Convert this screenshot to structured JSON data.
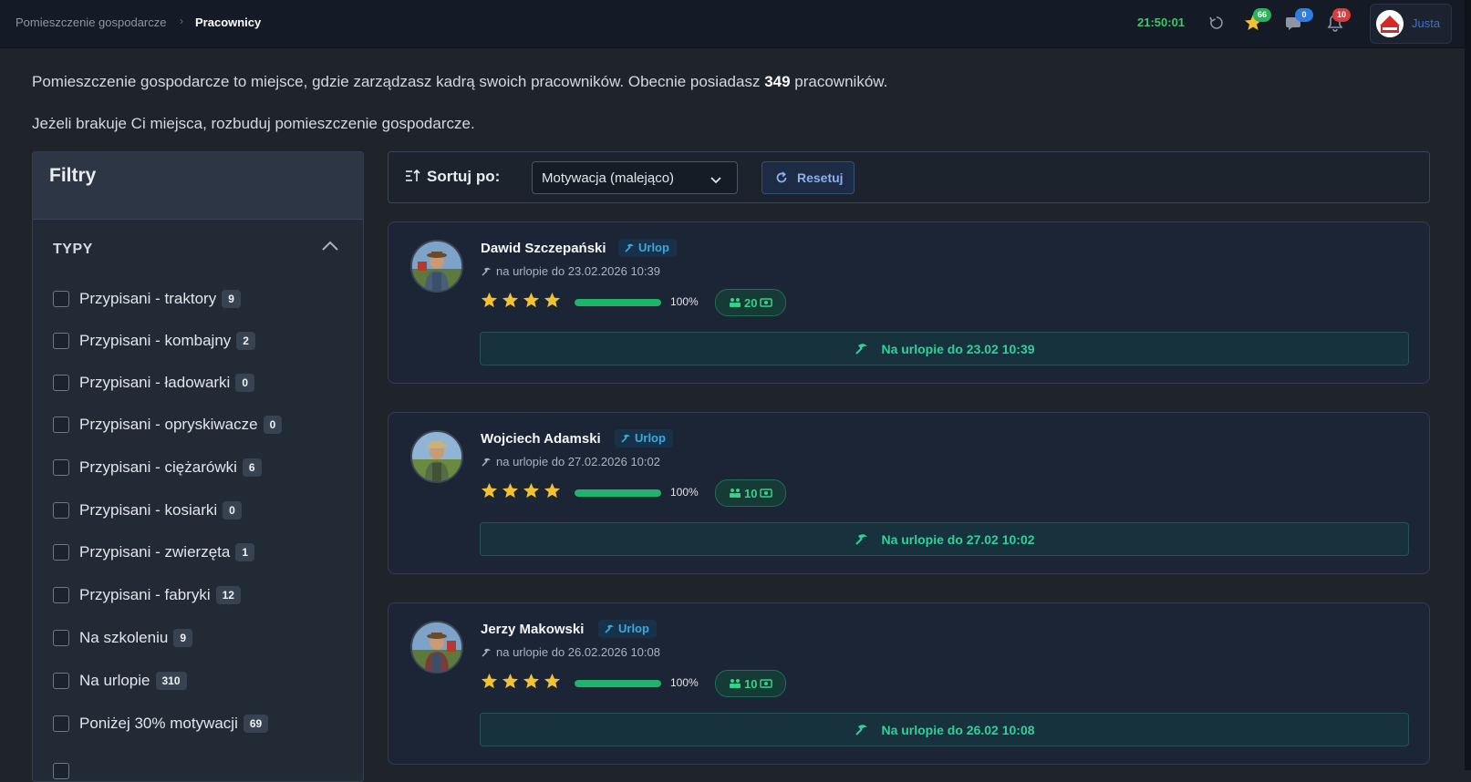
{
  "breadcrumb": {
    "parent": "Pomieszczenie gospodarcze",
    "separator": "›",
    "current": "Pracownicy"
  },
  "topbar": {
    "clock": "21:50:01",
    "favorites_count": "66",
    "messages_count": "0",
    "notifications_count": "10",
    "user_name": "Justa",
    "icons": [
      "refresh-icon",
      "star-icon",
      "chat-icon",
      "bell-icon"
    ]
  },
  "intro": {
    "line1_before": "Pomieszczenie gospodarcze to miejsce, gdzie zarządzasz kadrą swoich pracowników. Obecnie posiadasz ",
    "line1_count": "349",
    "line1_after": " pracowników.",
    "line2": "Jeżeli brakuje Ci miejsca, rozbuduj pomieszczenie gospodarcze."
  },
  "filters": {
    "title": "Filtry",
    "section": "TYPY",
    "items": [
      {
        "label": "Przypisani - traktory",
        "count": "9"
      },
      {
        "label": "Przypisani - kombajny",
        "count": "2"
      },
      {
        "label": "Przypisani - ładowarki",
        "count": "0"
      },
      {
        "label": "Przypisani - opryskiwacze",
        "count": "0"
      },
      {
        "label": "Przypisani - ciężarówki",
        "count": "6"
      },
      {
        "label": "Przypisani - kosiarki",
        "count": "0"
      },
      {
        "label": "Przypisani - zwierzęta",
        "count": "1"
      },
      {
        "label": "Przypisani - fabryki",
        "count": "12"
      },
      {
        "label": "Na szkoleniu",
        "count": "9"
      },
      {
        "label": "Na urlopie",
        "count": "310"
      },
      {
        "label": "Poniżej 30% motywacji",
        "count": "69"
      }
    ]
  },
  "sort": {
    "label": "Sortuj po:",
    "selected": "Motywacja (malejąco)",
    "reset_label": "Resetuj"
  },
  "colors": {
    "accent_green": "#1fb36b",
    "badge_green": "#2bb35a",
    "badge_blue": "#2f7de0",
    "badge_red": "#e03b3b",
    "star_yellow": "#f2c230"
  },
  "workers": [
    {
      "name": "Dawid Szczepański",
      "status": "Urlop",
      "leave_text": "na urlopie do 23.02.2026 10:39",
      "stars": 4,
      "motivation": 1.0,
      "motivation_label": "100%",
      "pay": "20",
      "vacation_banner": "Na urlopie do 23.02 10:39"
    },
    {
      "name": "Wojciech Adamski",
      "status": "Urlop",
      "leave_text": "na urlopie do 27.02.2026 10:02",
      "stars": 4,
      "motivation": 1.0,
      "motivation_label": "100%",
      "pay": "10",
      "vacation_banner": "Na urlopie do 27.02 10:02"
    },
    {
      "name": "Jerzy Makowski",
      "status": "Urlop",
      "leave_text": "na urlopie do 26.02.2026 10:08",
      "stars": 4,
      "motivation": 1.0,
      "motivation_label": "100%",
      "pay": "10",
      "vacation_banner": "Na urlopie do 26.02 10:08"
    }
  ]
}
